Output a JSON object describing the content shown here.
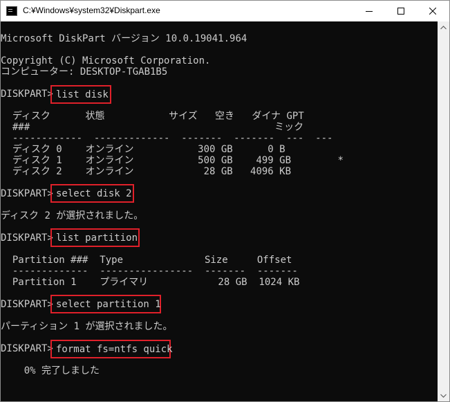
{
  "window": {
    "title": "C:¥Windows¥system32¥Diskpart.exe",
    "icon": "console-app-icon",
    "controls": [
      "minimize-icon",
      "maximize-icon",
      "close-icon"
    ]
  },
  "console": {
    "header": "Microsoft DiskPart バージョン 10.0.19041.964",
    "copyright": "Copyright (C) Microsoft Corporation.",
    "computer": "コンピューター: DESKTOP-TGAB1B5",
    "prompt": "DISKPART>",
    "cmd1": "list disk",
    "disk_header_1": "  ディスク      状態           サイズ   空き   ダイナ GPT",
    "disk_header_2": "  ###                                          ミック",
    "disk_sep": "  ------------  -------------  -------  -------  ---  ---",
    "disk_rows": [
      "  ディスク 0    オンライン           300 GB      0 B",
      "  ディスク 1    オンライン           500 GB    499 GB        *",
      "  ディスク 2    オンライン            28 GB   4096 KB"
    ],
    "cmd2": "select disk 2",
    "msg2": "ディスク 2 が選択されました。",
    "cmd3": "list partition",
    "part_header": "  Partition ###  Type              Size     Offset",
    "part_sep": "  -------------  ----------------  -------  -------",
    "part_row": "  Partition 1    プライマリ            28 GB  1024 KB",
    "cmd4": "select partition 1",
    "msg4": "パーティション 1 が選択されました。",
    "cmd5": "format fs=ntfs quick",
    "progress": "    0% 完了しました"
  },
  "colors": {
    "console_bg": "#0c0c0c",
    "console_text": "#cccccc",
    "highlight_border": "#e0202a"
  }
}
